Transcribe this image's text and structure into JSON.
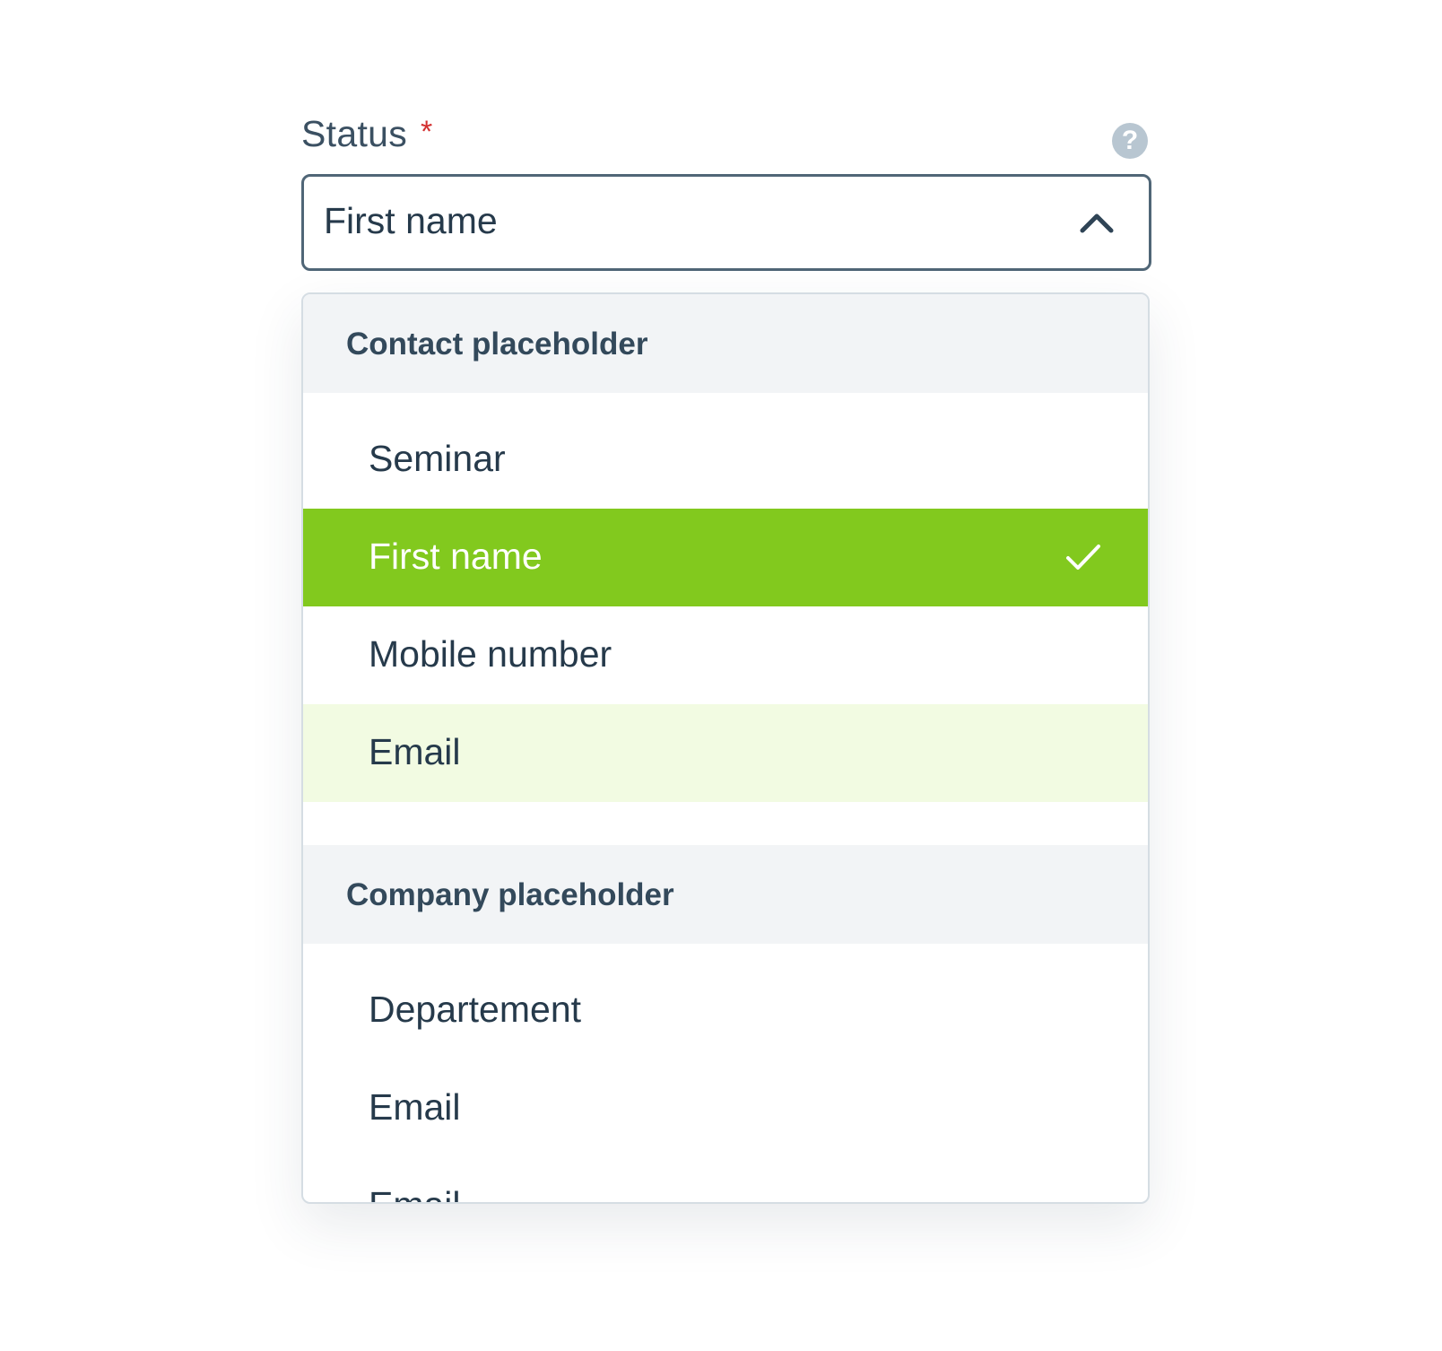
{
  "field": {
    "label": "Status",
    "required_mark": "*",
    "help_icon": "question-icon",
    "selected_value": "First name",
    "toggle_icon": "chevron-up-icon"
  },
  "dropdown": {
    "groups": [
      {
        "header": "Contact placeholder",
        "options": [
          {
            "label": "Seminar",
            "state": "normal"
          },
          {
            "label": "First name",
            "state": "selected"
          },
          {
            "label": "Mobile number",
            "state": "normal"
          },
          {
            "label": "Email",
            "state": "hover"
          }
        ]
      },
      {
        "header": "Company placeholder",
        "options": [
          {
            "label": "Departement",
            "state": "normal"
          },
          {
            "label": "Email",
            "state": "normal"
          },
          {
            "label": "Email",
            "state": "normal"
          }
        ]
      }
    ]
  },
  "colors": {
    "selected_bg": "#82c91e",
    "hover_bg": "#f2fbe2",
    "group_header_bg": "#f2f4f6",
    "text": "#263a4b",
    "required": "#d32f2f"
  }
}
